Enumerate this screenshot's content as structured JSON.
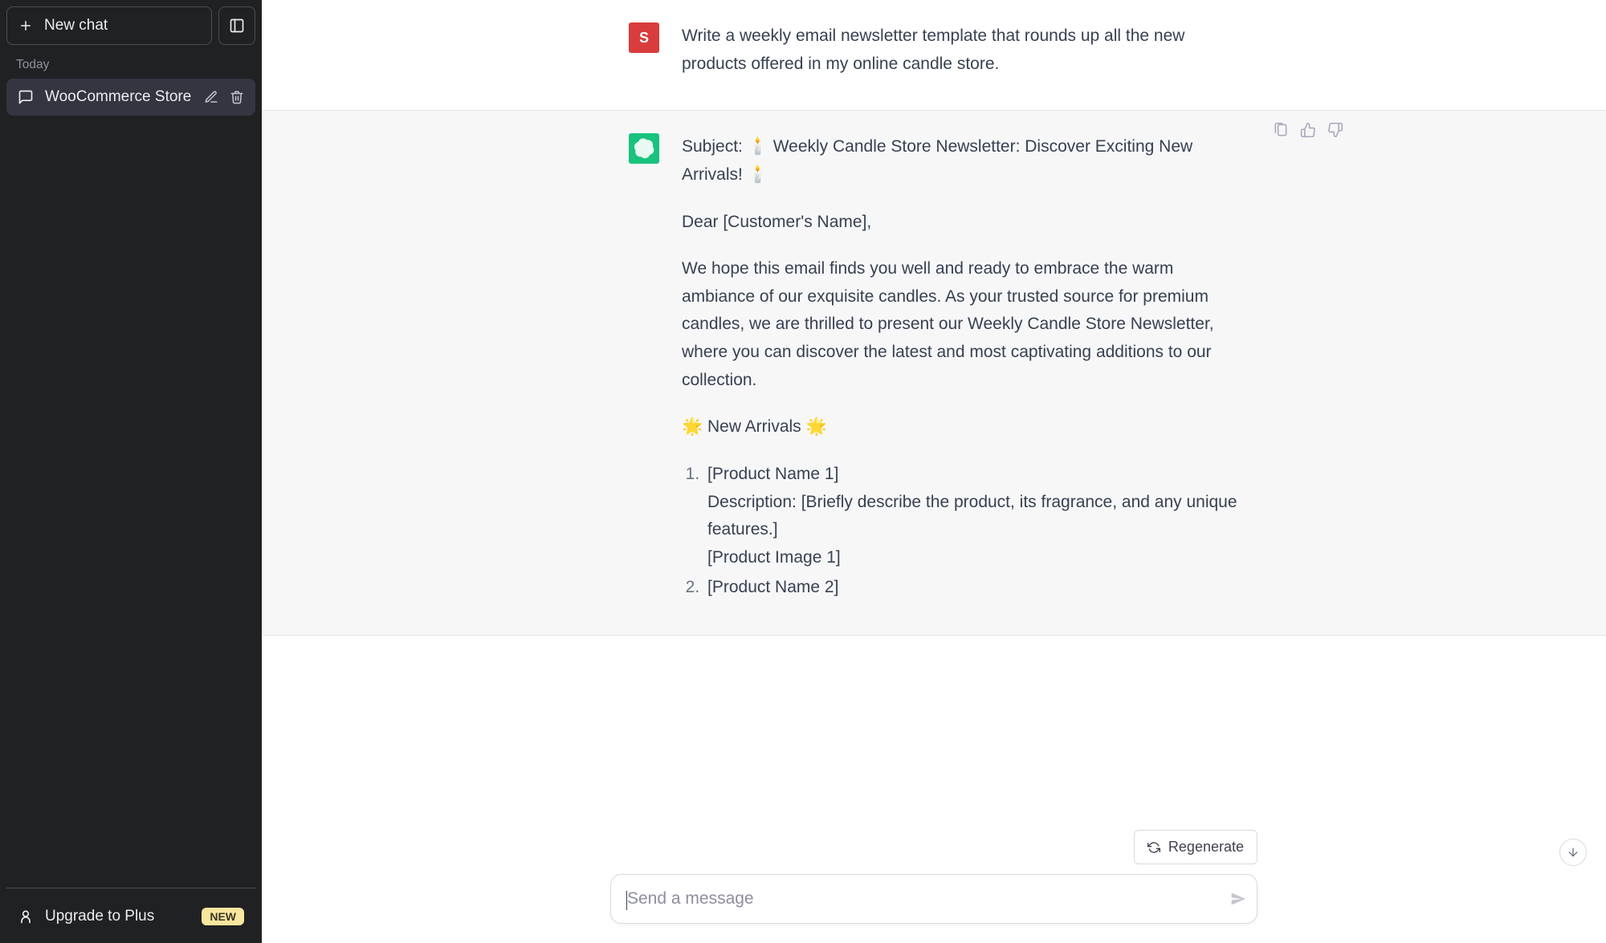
{
  "sidebar": {
    "new_chat_label": "New chat",
    "section_label": "Today",
    "conversations": [
      {
        "title": "WooCommerce Store"
      }
    ],
    "upgrade_label": "Upgrade to Plus",
    "upgrade_badge": "NEW"
  },
  "messages": {
    "user": {
      "avatar_letter": "S",
      "text": "Write a weekly email newsletter template that rounds up all the new products offered in my online candle store."
    },
    "assistant": {
      "subject": "Subject: 🕯️ Weekly Candle Store Newsletter: Discover Exciting New Arrivals! 🕯️",
      "greeting": "Dear [Customer's Name],",
      "intro": "We hope this email finds you well and ready to embrace the warm ambiance of our exquisite candles. As your trusted source for premium candles, we are thrilled to present our Weekly Candle Store Newsletter, where you can discover the latest and most captivating additions to our collection.",
      "arrivals_heading": "🌟 New Arrivals 🌟",
      "products": [
        {
          "name": "[Product Name 1]",
          "description": "Description: [Briefly describe the product, its fragrance, and any unique features.]",
          "image": "[Product Image 1]"
        },
        {
          "name": "[Product Name 2]"
        }
      ]
    }
  },
  "composer": {
    "regenerate_label": "Regenerate",
    "placeholder": "Send a message"
  }
}
